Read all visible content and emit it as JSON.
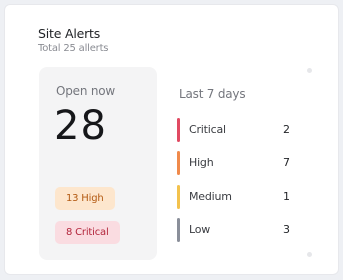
{
  "card": {
    "title": "Site Alerts",
    "subtitle": "Total 25 allerts"
  },
  "open_now": {
    "label": "Open now",
    "count": "28",
    "chips": [
      {
        "label": "13 High",
        "color": "#fde6cd",
        "text_color": "#b35a12"
      },
      {
        "label": "8 Critical",
        "color": "#fadce1",
        "text_color": "#b3263c"
      }
    ]
  },
  "last_7_days": {
    "label": "Last 7 days",
    "rows": [
      {
        "name": "Critical",
        "count": "2",
        "color": "#e14a62"
      },
      {
        "name": "High",
        "count": "7",
        "color": "#f08a4b"
      },
      {
        "name": "Medium",
        "count": "1",
        "color": "#f3c24d"
      },
      {
        "name": "Low",
        "count": "3",
        "color": "#8a8f9a"
      }
    ]
  }
}
